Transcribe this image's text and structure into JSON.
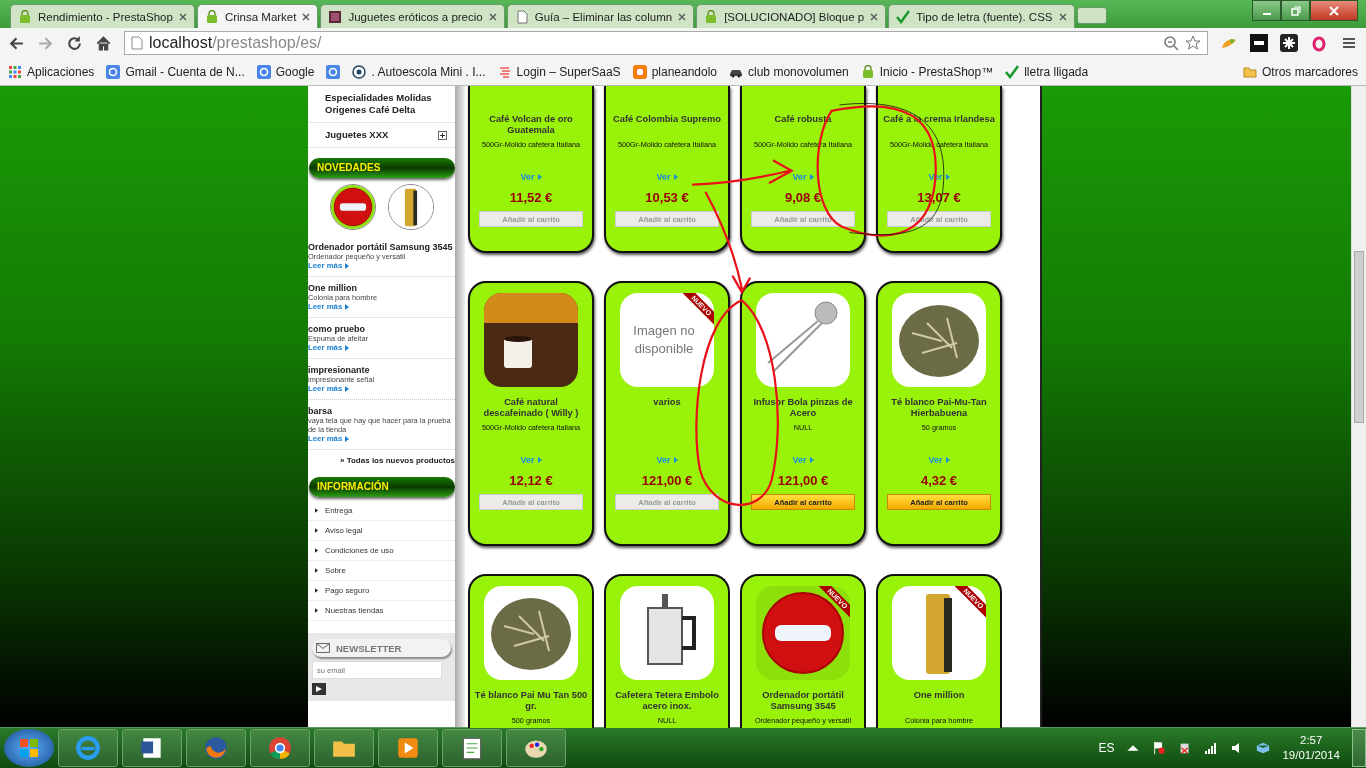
{
  "browser": {
    "tabs": [
      {
        "title": "Rendimiento - PrestaShop",
        "kind": "shop",
        "selected": false
      },
      {
        "title": "Crinsa Market",
        "kind": "shop",
        "selected": true
      },
      {
        "title": "Juguetes eróticos a precio",
        "kind": "image",
        "selected": false
      },
      {
        "title": "Guía – Eliminar las column",
        "kind": "page",
        "selected": false
      },
      {
        "title": "[SOLUCIONADO] Bloque p",
        "kind": "shop",
        "selected": false
      },
      {
        "title": "Tipo de letra (fuente). CSS",
        "kind": "check",
        "selected": false
      }
    ],
    "address": {
      "host": "localhost",
      "path": "/prestashop/es/"
    },
    "bookmarks": [
      {
        "label": "Aplicaciones",
        "kind": "apps"
      },
      {
        "label": "Gmail - Cuenta de N...",
        "kind": "google"
      },
      {
        "label": "Google",
        "kind": "google"
      },
      {
        "kind": "google"
      },
      {
        "label": ". Autoescola Mini . I...",
        "kind": "circle"
      },
      {
        "label": "Login – SuperSaaS",
        "kind": "saas"
      },
      {
        "label": "planeandolo",
        "kind": "blogger"
      },
      {
        "label": "club monovolumen",
        "kind": "car"
      },
      {
        "label": "Inicio - PrestaShop™",
        "kind": "shop"
      },
      {
        "label": "lletra lligada",
        "kind": "check"
      }
    ],
    "other_bookmarks": "Otros marcadores"
  },
  "sidebar": {
    "categories": [
      {
        "label": "Especialidades Molidas Origenes Café Delta",
        "expandable": false
      },
      {
        "label": "Juguetes XXX",
        "expandable": true
      }
    ],
    "new_products": {
      "title": "NOVEDADES",
      "thumbnails": [
        {
          "kind": "noentry"
        },
        {
          "kind": "perfume"
        }
      ],
      "items": [
        {
          "name": "Ordenador portátil Samsung 3545",
          "description": "Ordenador pequeño y versatil",
          "link": "Leer más"
        },
        {
          "name": "One million",
          "description": "Colonia para hombre",
          "link": "Leer más"
        },
        {
          "name": "como pruebo",
          "description": "Espuma de afeitar",
          "link": "Leer más"
        },
        {
          "name": "impresionante",
          "description": "impresionante señal",
          "link": "Leer más"
        },
        {
          "name": "barsa",
          "description": "vaya tela que hay que hacer para la prueba de la tienda",
          "link": "Leer más"
        }
      ],
      "all_link": "» Todas los nuevos productos"
    },
    "information": {
      "title": "INFORMACIÓN",
      "links": [
        "Entrega",
        "Aviso legal",
        "Condiciones de uso",
        "Sobre",
        "Pago seguro",
        "Nuestras tiendas"
      ]
    },
    "newsletter": {
      "title": "NEWSLETTER",
      "placeholder": "su email"
    }
  },
  "product_rows": [
    [
      {
        "name": "Café Volcan de oro Guatemala",
        "description": "500Gr-Molido cafetera Italiana",
        "link": "Ver",
        "price": "11,52 €",
        "button": {
          "label": "Añadir al carrito",
          "enabled": false
        }
      },
      {
        "name": "Café Colombia Supremo",
        "description": "500Gr-Molido cafetera Italiana",
        "link": "Ver",
        "price": "10,53 €",
        "button": {
          "label": "Añadir al carrito",
          "enabled": false
        }
      },
      {
        "name": "Café robusta",
        "description": "500Gr-Molido cafetera Italiana",
        "link": "Ver",
        "price": "9,08 €",
        "button": {
          "label": "Añadir al carrito",
          "enabled": false
        }
      },
      {
        "name": "Café a la crema Irlandesa",
        "description": "500Gr-Molido cafetera Italiana",
        "link": "Ver",
        "price": "13,07 €",
        "button": {
          "label": "Añadir al carrito",
          "enabled": false
        }
      }
    ],
    [
      {
        "image": {
          "kind": "coffee"
        },
        "name": "Café natural descafeinado ( Willy )",
        "description": "500Gr-Molido cafetera Italiana",
        "link": "Ver",
        "price": "12,12 €",
        "button": {
          "label": "Añadir al carrito",
          "enabled": false
        }
      },
      {
        "image": {
          "kind": "missing",
          "text": "Imagen no disponible"
        },
        "badge": "NUEVO",
        "name": "varios",
        "link": "Ver",
        "price": "121,00 €",
        "button": {
          "label": "Añadir al carrito",
          "enabled": false
        }
      },
      {
        "image": {
          "kind": "infuser"
        },
        "name": "Infusor Bola pinzas de Acero",
        "description": "NULL",
        "link": "Ver",
        "price": "121,00 €",
        "button": {
          "label": "Añadir al carrito",
          "enabled": true
        }
      },
      {
        "image": {
          "kind": "tea"
        },
        "name": "Té blanco Pai-Mu-Tan Hierbabuena",
        "description": "50 gramos",
        "link": "Ver",
        "price": "4,32 €",
        "button": {
          "label": "Añadir al carrito",
          "enabled": true
        }
      }
    ],
    [
      {
        "image": {
          "kind": "tea"
        },
        "name": "Té blanco Pai Mu Tan 500 gr.",
        "description": "500 gramos"
      },
      {
        "image": {
          "kind": "press"
        },
        "name": "Cafetera Tetera Embolo acero inox.",
        "description": "NULL"
      },
      {
        "image": {
          "kind": "noentry"
        },
        "badge": "NUEVO",
        "name": "Ordenador portátil Samsung 3545",
        "description": "Ordenador pequeño y versatil"
      },
      {
        "image": {
          "kind": "perfume"
        },
        "badge": "NUEVO",
        "name": "One million",
        "description": "Colonia para hombre"
      }
    ]
  ],
  "taskbar": {
    "apps": [
      {
        "kind": "ie"
      },
      {
        "kind": "word"
      },
      {
        "kind": "firefox"
      },
      {
        "kind": "chrome"
      },
      {
        "kind": "explorer"
      },
      {
        "kind": "media"
      },
      {
        "kind": "notepad"
      },
      {
        "kind": "paint"
      }
    ],
    "language": "ES",
    "time": "2:57",
    "date": "19/01/2014"
  }
}
